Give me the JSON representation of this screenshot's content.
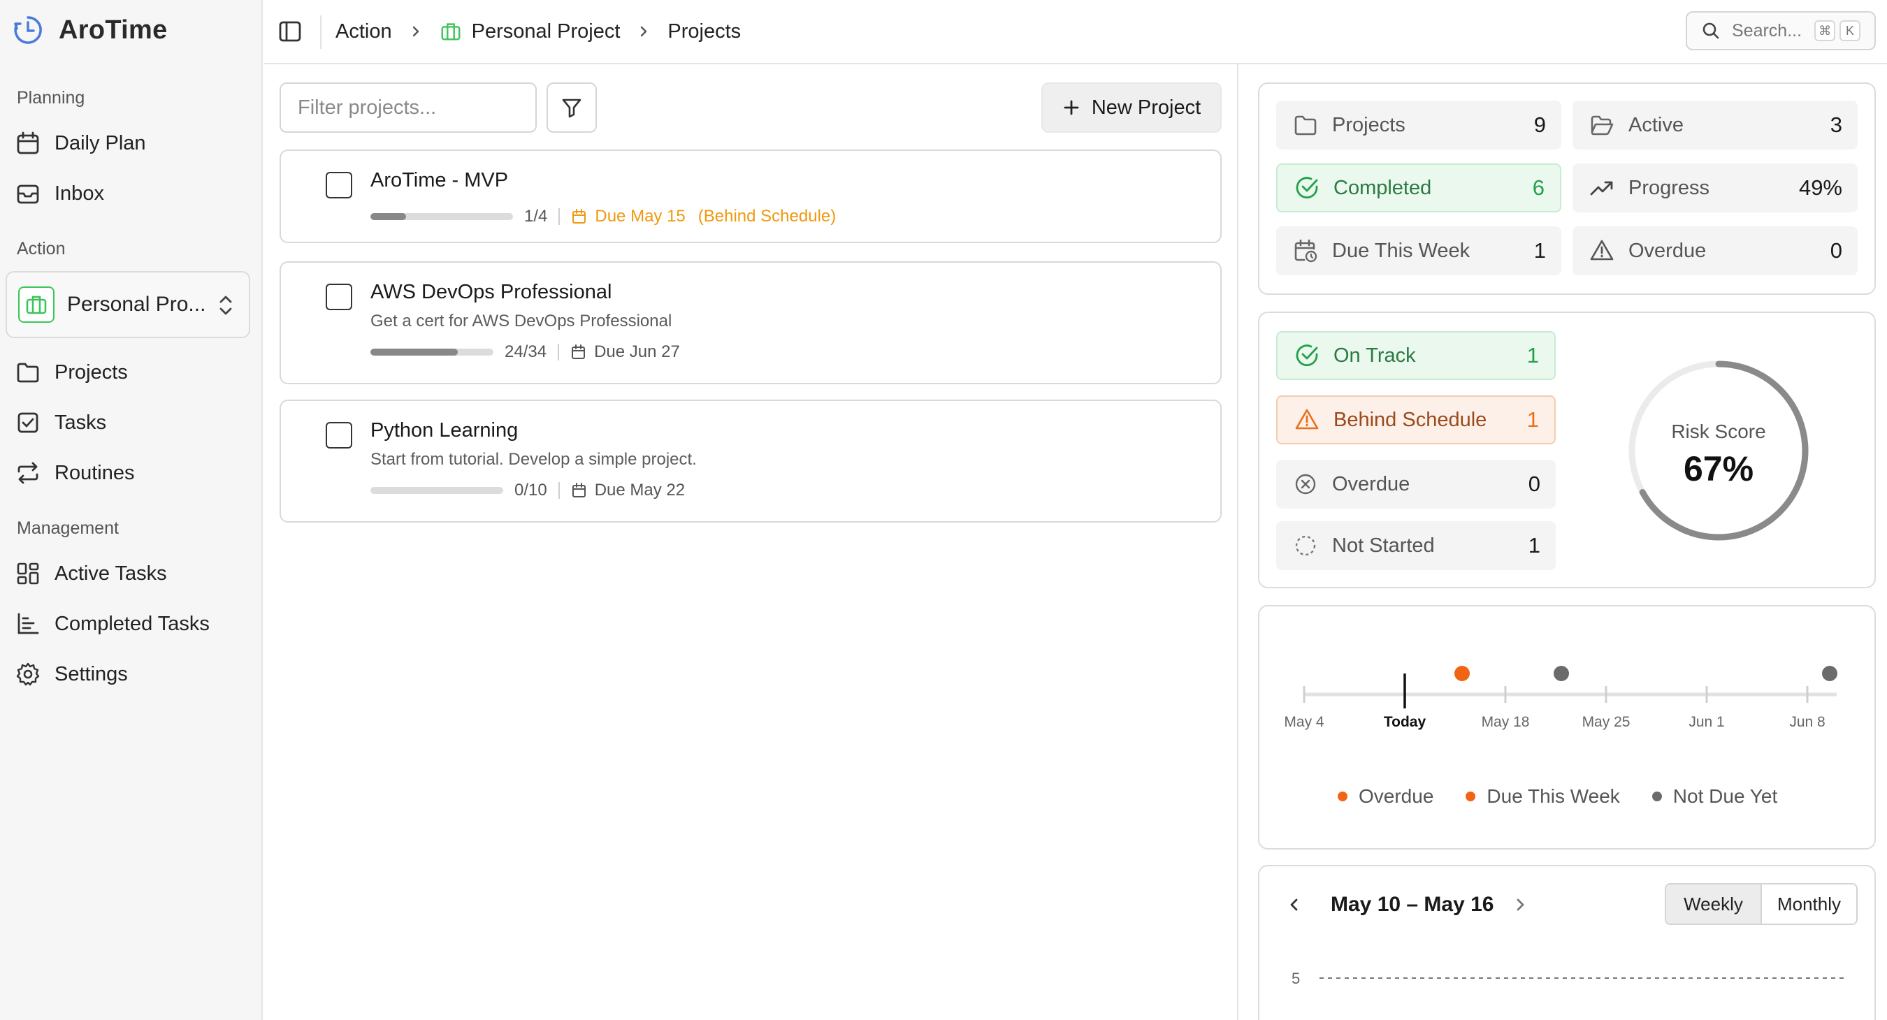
{
  "app": {
    "name": "AroTime"
  },
  "sidebar": {
    "planning_label": "Planning",
    "planning_items": [
      {
        "label": "Daily Plan",
        "icon": "calendar-icon"
      },
      {
        "label": "Inbox",
        "icon": "inbox-icon"
      }
    ],
    "action_label": "Action",
    "project_selector": {
      "value": "Personal Pro...",
      "icon": "briefcase-icon"
    },
    "action_items": [
      {
        "label": "Projects",
        "icon": "folder-icon"
      },
      {
        "label": "Tasks",
        "icon": "checkbox-icon"
      },
      {
        "label": "Routines",
        "icon": "repeat-icon"
      }
    ],
    "management_label": "Management",
    "management_items": [
      {
        "label": "Active Tasks",
        "icon": "grid-icon"
      },
      {
        "label": "Completed Tasks",
        "icon": "list-chart-icon"
      },
      {
        "label": "Settings",
        "icon": "gear-icon"
      }
    ]
  },
  "breadcrumb": {
    "items": [
      "Action",
      "Personal Project",
      "Projects"
    ]
  },
  "search": {
    "placeholder": "Search...",
    "shortcut_mod": "⌘",
    "shortcut_key": "K"
  },
  "toolbar": {
    "filter_placeholder": "Filter projects...",
    "new_project_label": "New Project"
  },
  "projects": [
    {
      "title": "AroTime - MVP",
      "description": "",
      "progress_text": "1/4",
      "progress": 0.25,
      "due": "Due May 15",
      "status": "(Behind Schedule)"
    },
    {
      "title": "AWS DevOps Professional",
      "description": "Get a cert for AWS DevOps Professional",
      "progress_text": "24/34",
      "progress": 0.71,
      "due": "Due Jun 27",
      "status": ""
    },
    {
      "title": "Python Learning",
      "description": "Start from tutorial. Develop a simple project.",
      "progress_text": "0/10",
      "progress": 0.0,
      "due": "Due May 22",
      "status": ""
    }
  ],
  "stats": {
    "projects": {
      "label": "Projects",
      "value": "9"
    },
    "active": {
      "label": "Active",
      "value": "3"
    },
    "completed": {
      "label": "Completed",
      "value": "6"
    },
    "progress": {
      "label": "Progress",
      "value": "49%"
    },
    "due_this_week": {
      "label": "Due This Week",
      "value": "1"
    },
    "overdue": {
      "label": "Overdue",
      "value": "0"
    }
  },
  "health": {
    "on_track": {
      "label": "On Track",
      "value": "1"
    },
    "behind": {
      "label": "Behind Schedule",
      "value": "1"
    },
    "overdue": {
      "label": "Overdue",
      "value": "0"
    },
    "not_started": {
      "label": "Not Started",
      "value": "1"
    },
    "risk_label": "Risk Score",
    "risk_value": "67%",
    "risk_fraction": 0.67
  },
  "timeline": {
    "ticks": [
      "May 4",
      "Today",
      "May 18",
      "May 25",
      "Jun 1",
      "Jun 8"
    ],
    "legend": [
      {
        "label": "Overdue",
        "color": "#f06414"
      },
      {
        "label": "Due This Week",
        "color": "#f06414"
      },
      {
        "label": "Not Due Yet",
        "color": "#6b6b6b"
      }
    ]
  },
  "week": {
    "range": "May 10 – May 16",
    "view_options": [
      "Weekly",
      "Monthly"
    ],
    "y_tick": "5"
  },
  "colors": {
    "accent_green": "#3cc55a",
    "accent_orange": "#f06414",
    "warn": "#f0990e"
  }
}
